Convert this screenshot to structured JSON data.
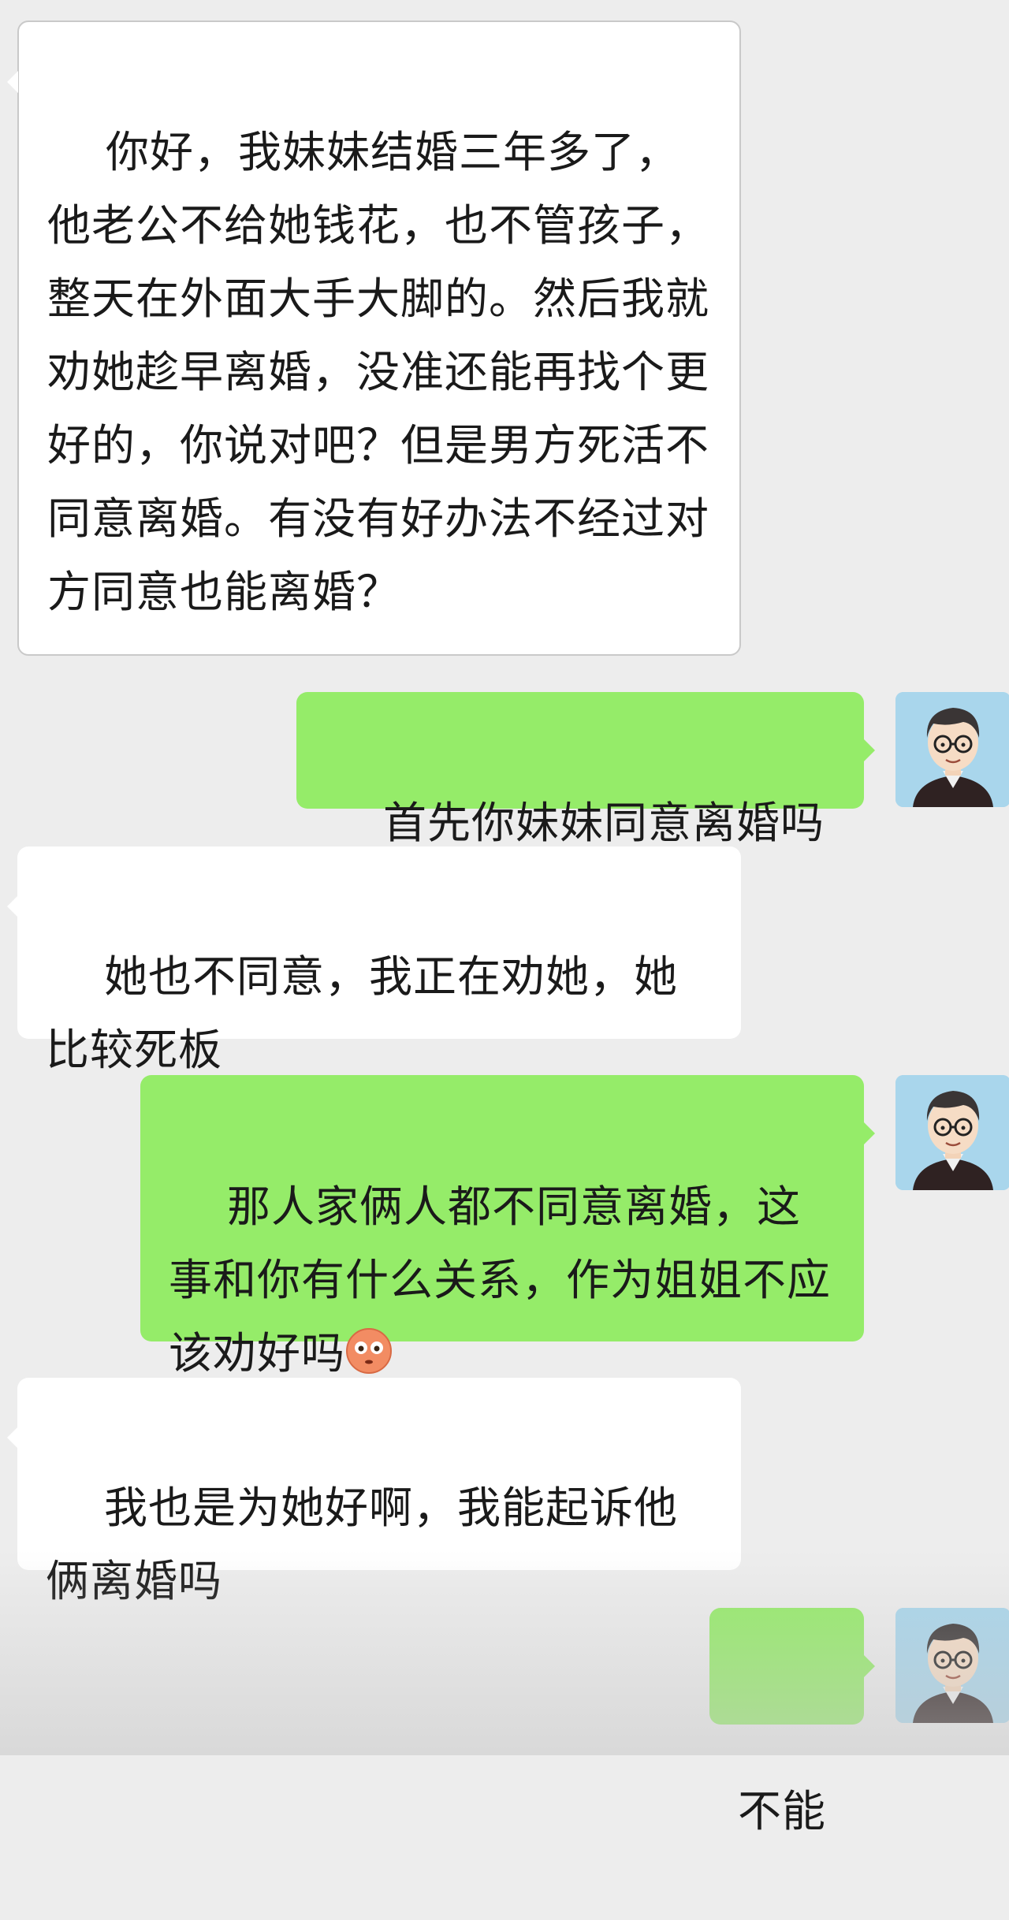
{
  "messages": [
    {
      "side": "left",
      "text": "你好，我妹妹结婚三年多了，他老公不给她钱花，也不管孩子，整天在外面大手大脚的。然后我就劝她趁早离婚，没准还能再找个更好的，你说对吧？但是男方死活不同意离婚。有没有好办法不经过对方同意也能离婚？"
    },
    {
      "side": "right",
      "text": "首先你妹妹同意离婚吗"
    },
    {
      "side": "left",
      "text": "她也不同意，我正在劝她，她比较死板"
    },
    {
      "side": "right",
      "text": "那人家俩人都不同意离婚，这事和你有什么关系，作为姐姐不应该劝好吗",
      "emoji": "flushed-face-emoji"
    },
    {
      "side": "left",
      "text": "我也是为她好啊，我能起诉他俩离婚吗"
    },
    {
      "side": "right",
      "text": "不能"
    }
  ],
  "colors": {
    "background": "#ededed",
    "self_bubble": "#95ec69",
    "other_bubble": "#ffffff",
    "avatar_bg": "#a9d6ec"
  },
  "icons": {
    "avatar": "cartoon-man-with-glasses-avatar",
    "emoji": "flushed-face-emoji"
  }
}
